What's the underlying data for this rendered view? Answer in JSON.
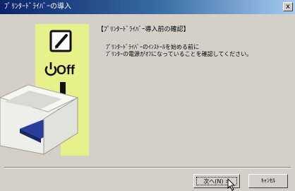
{
  "window": {
    "title": "ﾌﾟﾘﾝﾀｰﾄﾞﾗｲﾊﾞｰの導入",
    "close_glyph": "x"
  },
  "illustration": {
    "off_label": "Off",
    "power_symbol": "⏻",
    "icons": [
      "checkbox-pencil-icon",
      "power-off-icon",
      "arrow-down-icon",
      "printer-icon"
    ],
    "colors": {
      "highlight": "#e8f08a",
      "arrow": "#111111",
      "printer_tray": "#2a3d9a"
    }
  },
  "content": {
    "heading": "【ﾌﾟﾘﾝﾀｰﾄﾞﾗｲﾊﾞｰ導入前の確認】",
    "body_line1": "ﾌﾟﾘﾝﾀｰﾄﾞﾗｲﾊﾞｰのｲﾝｽﾄｰﾙを始める前に",
    "body_line2": "ﾌﾟﾘﾝﾀｰの電源がｵﾌになっていることを確認してください。"
  },
  "buttons": {
    "next_label": "次へ(N) >",
    "cancel_label": "ｷｬﾝｾﾙ"
  }
}
